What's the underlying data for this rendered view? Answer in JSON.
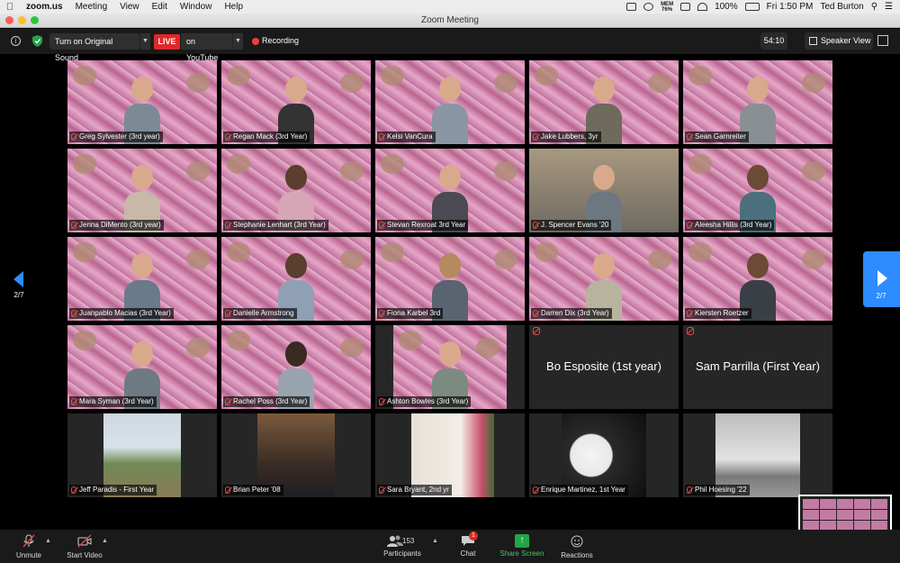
{
  "menubar": {
    "app": "zoom.us",
    "items": [
      "Meeting",
      "View",
      "Edit",
      "Window",
      "Help"
    ],
    "memory_label": "MEM",
    "memory_value": "76%",
    "battery": "100%",
    "clock": "Fri 1:50 PM",
    "user": "Ted Burton"
  },
  "window": {
    "title": "Zoom Meeting"
  },
  "toolbar": {
    "original_sound": "Turn on Original Sound",
    "live_badge": "LIVE",
    "live_target": "on YouTube",
    "recording": "Recording",
    "timer": "54:10",
    "view_mode": "Speaker View"
  },
  "pager": {
    "left_label": "2/7",
    "right_label": "2/7"
  },
  "participants": [
    {
      "name": "Greg Sylvester (3rd year)",
      "muted": true,
      "bg": "pink"
    },
    {
      "name": "Regan Mack (3rd Year)",
      "muted": true,
      "bg": "pink"
    },
    {
      "name": "Kelsi VanCura",
      "muted": true,
      "bg": "pink"
    },
    {
      "name": "Jake Lubbers, 3yr",
      "muted": true,
      "bg": "pink"
    },
    {
      "name": "Sean Garnreiter",
      "muted": true,
      "bg": "pink"
    },
    {
      "name": "Jenna DiMento (3rd year)",
      "muted": true,
      "bg": "pink"
    },
    {
      "name": "Stephanie Lenhart (3rd Year)",
      "muted": true,
      "bg": "pink"
    },
    {
      "name": "Stevan Rexroat 3rd Year",
      "muted": true,
      "bg": "pink"
    },
    {
      "name": "J. Spencer Evans '20",
      "muted": true,
      "bg": "room"
    },
    {
      "name": "Aleesha Hillis (3rd Year)",
      "muted": true,
      "bg": "pink"
    },
    {
      "name": "Juanpablo Macias (3rd Year)",
      "muted": true,
      "bg": "pink"
    },
    {
      "name": "Danielle Armstrong",
      "muted": true,
      "bg": "pink"
    },
    {
      "name": "Fiona Karbel 3rd",
      "muted": true,
      "bg": "pink"
    },
    {
      "name": "Darren Dix (3rd Year)",
      "muted": true,
      "bg": "pink"
    },
    {
      "name": "Kiersten Roetzer",
      "muted": true,
      "bg": "pink"
    },
    {
      "name": "Mara Syman (3rd Year)",
      "muted": true,
      "bg": "pink"
    },
    {
      "name": "Rachel Poss (3rd Year)",
      "muted": true,
      "bg": "pink"
    },
    {
      "name": "Ashton Bowles (3rd Year)",
      "muted": true,
      "bg": "pink-partial"
    },
    {
      "name": "Bo Esposite (1st year)",
      "muted": true,
      "bg": "none"
    },
    {
      "name": "Sam Parrilla (First Year)",
      "muted": true,
      "bg": "none"
    },
    {
      "name": "Jeff Paradis - First Year",
      "muted": true,
      "bg": "photo-outdoor"
    },
    {
      "name": "Brian Peter '08",
      "muted": true,
      "bg": "photo-bobblehead"
    },
    {
      "name": "Sara Bryant, 2nd yr",
      "muted": true,
      "bg": "photo-flowers"
    },
    {
      "name": "Enrique Martinez, 1st Year",
      "muted": true,
      "bg": "photo-drum"
    },
    {
      "name": "Phil Hoesing '22",
      "muted": true,
      "bg": "photo-plane"
    }
  ],
  "bottombar": {
    "unmute": "Unmute",
    "start_video": "Start Video",
    "participants": "Participants",
    "participant_count": "153",
    "chat": "Chat",
    "chat_badge": "1",
    "share_screen": "Share Screen",
    "reactions": "Reactions"
  },
  "colors": {
    "accent": "#2d8cff",
    "live": "#e02828",
    "share": "#23a44a",
    "muted_mic": "#e34a4a"
  }
}
